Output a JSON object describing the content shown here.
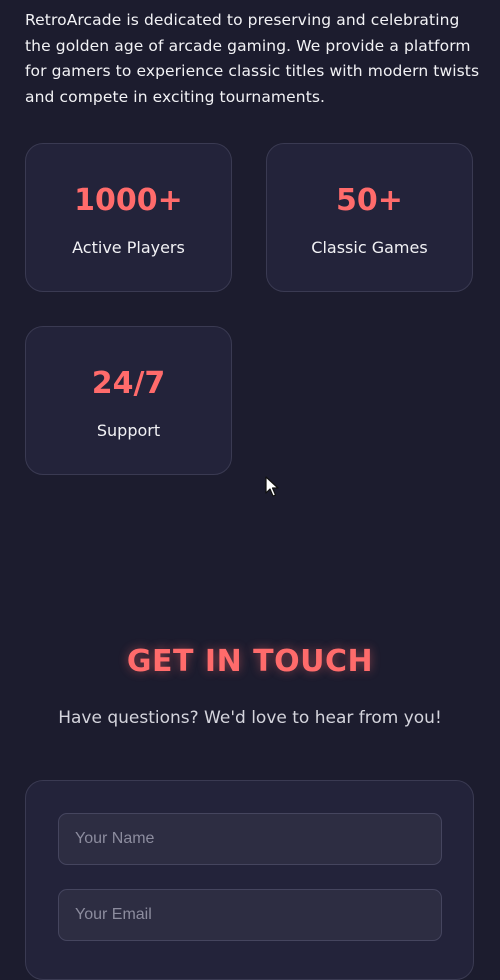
{
  "about": {
    "text": "RetroArcade is dedicated to preserving and celebrating the golden age of arcade gaming. We provide a platform for gamers to experience classic titles with modern twists and compete in exciting tournaments."
  },
  "stats": [
    {
      "value": "1000+",
      "label": "Active Players"
    },
    {
      "value": "50+",
      "label": "Classic Games"
    },
    {
      "value": "24/7",
      "label": "Support"
    }
  ],
  "contact": {
    "title": "GET IN TOUCH",
    "subtitle": "Have questions? We'd love to hear from you!",
    "name_placeholder": "Your Name",
    "email_placeholder": "Your Email"
  },
  "colors": {
    "background": "#1c1c2e",
    "card": "#23233a",
    "accent": "#ff6b6b",
    "input": "#2d2d42"
  },
  "icons": {
    "cursor": "mouse-pointer-icon"
  }
}
